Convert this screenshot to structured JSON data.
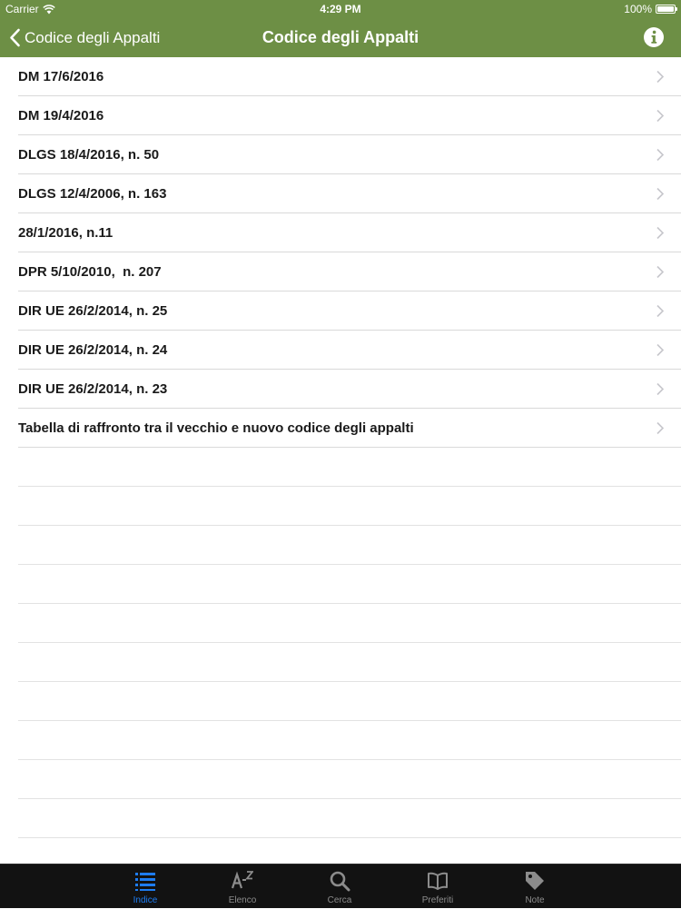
{
  "status_bar": {
    "carrier": "Carrier",
    "time": "4:29 PM",
    "battery": "100%"
  },
  "nav": {
    "back_label": "Codice degli Appalti",
    "title": "Codice degli Appalti",
    "info_icon": "info-icon"
  },
  "list": {
    "items": [
      {
        "label": "DM 17/6/2016"
      },
      {
        "label": "DM 19/4/2016"
      },
      {
        "label": "DLGS 18/4/2016, n. 50"
      },
      {
        "label": "DLGS 12/4/2006, n. 163"
      },
      {
        "label": "28/1/2016, n.11"
      },
      {
        "label": "DPR 5/10/2010,  n. 207"
      },
      {
        "label": "DIR UE 26/2/2014, n. 25"
      },
      {
        "label": "DIR UE 26/2/2014, n. 24"
      },
      {
        "label": "DIR UE 26/2/2014, n. 23"
      },
      {
        "label": "Tabella di raffronto tra il vecchio e nuovo codice degli appalti"
      }
    ]
  },
  "tab_bar": {
    "tabs": [
      {
        "label": "Indice",
        "icon": "list-icon",
        "active": true
      },
      {
        "label": "Elenco",
        "icon": "a-z-icon",
        "active": false
      },
      {
        "label": "Cerca",
        "icon": "search-icon",
        "active": false
      },
      {
        "label": "Preferiti",
        "icon": "book-icon",
        "active": false
      },
      {
        "label": "Note",
        "icon": "tag-icon",
        "active": false
      }
    ]
  },
  "colors": {
    "nav_green": "#6d8f45",
    "tab_bar_bg": "#121212",
    "tab_active": "#1e7cf0",
    "tab_inactive": "#8c8c8c"
  }
}
